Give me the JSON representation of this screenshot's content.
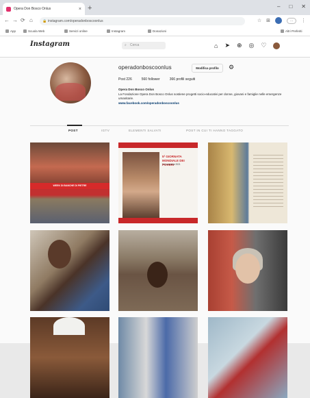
{
  "browser": {
    "tab_title": "Opera Don Bosco Onlus",
    "url": "instagram.com/operadonboscoonlus",
    "bookmarks": [
      "App",
      "Scuola Web",
      "Servizi online",
      "Instagram",
      "Donazioni",
      "Altri Preferiti"
    ]
  },
  "instagram": {
    "logo": "Instagram",
    "search_placeholder": "Cerca",
    "profile": {
      "username": "operadonboscoonlus",
      "edit_button": "Modifica profilo",
      "posts": "Post 226",
      "followers": "560 follower",
      "following": "366 profili seguiti",
      "bio_name": "Opera Don Bosco Onlus",
      "bio_text": "La Fondazione Opera Don Bosco Onlus sostiene progetti socio-educativi per donne, giovani e famiglie nelle emergenze umanitarie.",
      "bio_link": "www.facebook.com/operadonboscoonlus"
    },
    "tabs": [
      "POST",
      "IGTV",
      "ELEMENTI SALVATI",
      "POST IN CUI TI HANNO TAGGATO"
    ],
    "tiles": {
      "t1_band": "WEEK DI BANCHE DI PIETRE",
      "t2_title": "5ª GIORNATA MONDIALE DEI POVERI",
      "t2_tag": "14 novembre 2021"
    }
  }
}
